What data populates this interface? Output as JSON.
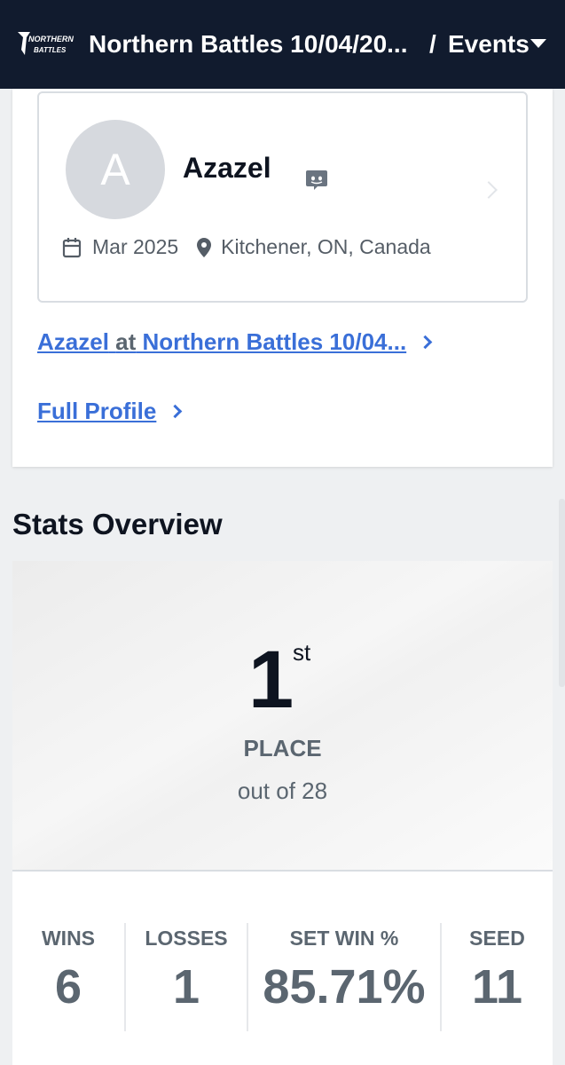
{
  "header": {
    "logo_text": "NORTHERN BATTLES",
    "event_title": "Northern Battles 10/04/20...",
    "breadcrumb_sep": "/",
    "breadcrumb_section": "Events"
  },
  "player_card": {
    "avatar_initial": "A",
    "name": "Azazel",
    "joined": "Mar 2025",
    "location": "Kitchener, ON, Canada"
  },
  "links": {
    "player_link": "Azazel",
    "at_text": "at",
    "event_link": "Northern Battles 10/04...",
    "full_profile": "Full Profile"
  },
  "stats": {
    "heading": "Stats Overview",
    "placement": "1",
    "placement_suffix": "st",
    "placement_label": "PLACE",
    "out_of": "out of 28",
    "columns": [
      {
        "label": "WINS",
        "value": "6"
      },
      {
        "label": "LOSSES",
        "value": "1"
      },
      {
        "label": "SET WIN %",
        "value": "85.71%"
      },
      {
        "label": "SEED",
        "value": "11"
      }
    ]
  },
  "colors": {
    "header_bg": "#111b2e",
    "link": "#3a6fd8",
    "muted_text": "#5b6670"
  }
}
